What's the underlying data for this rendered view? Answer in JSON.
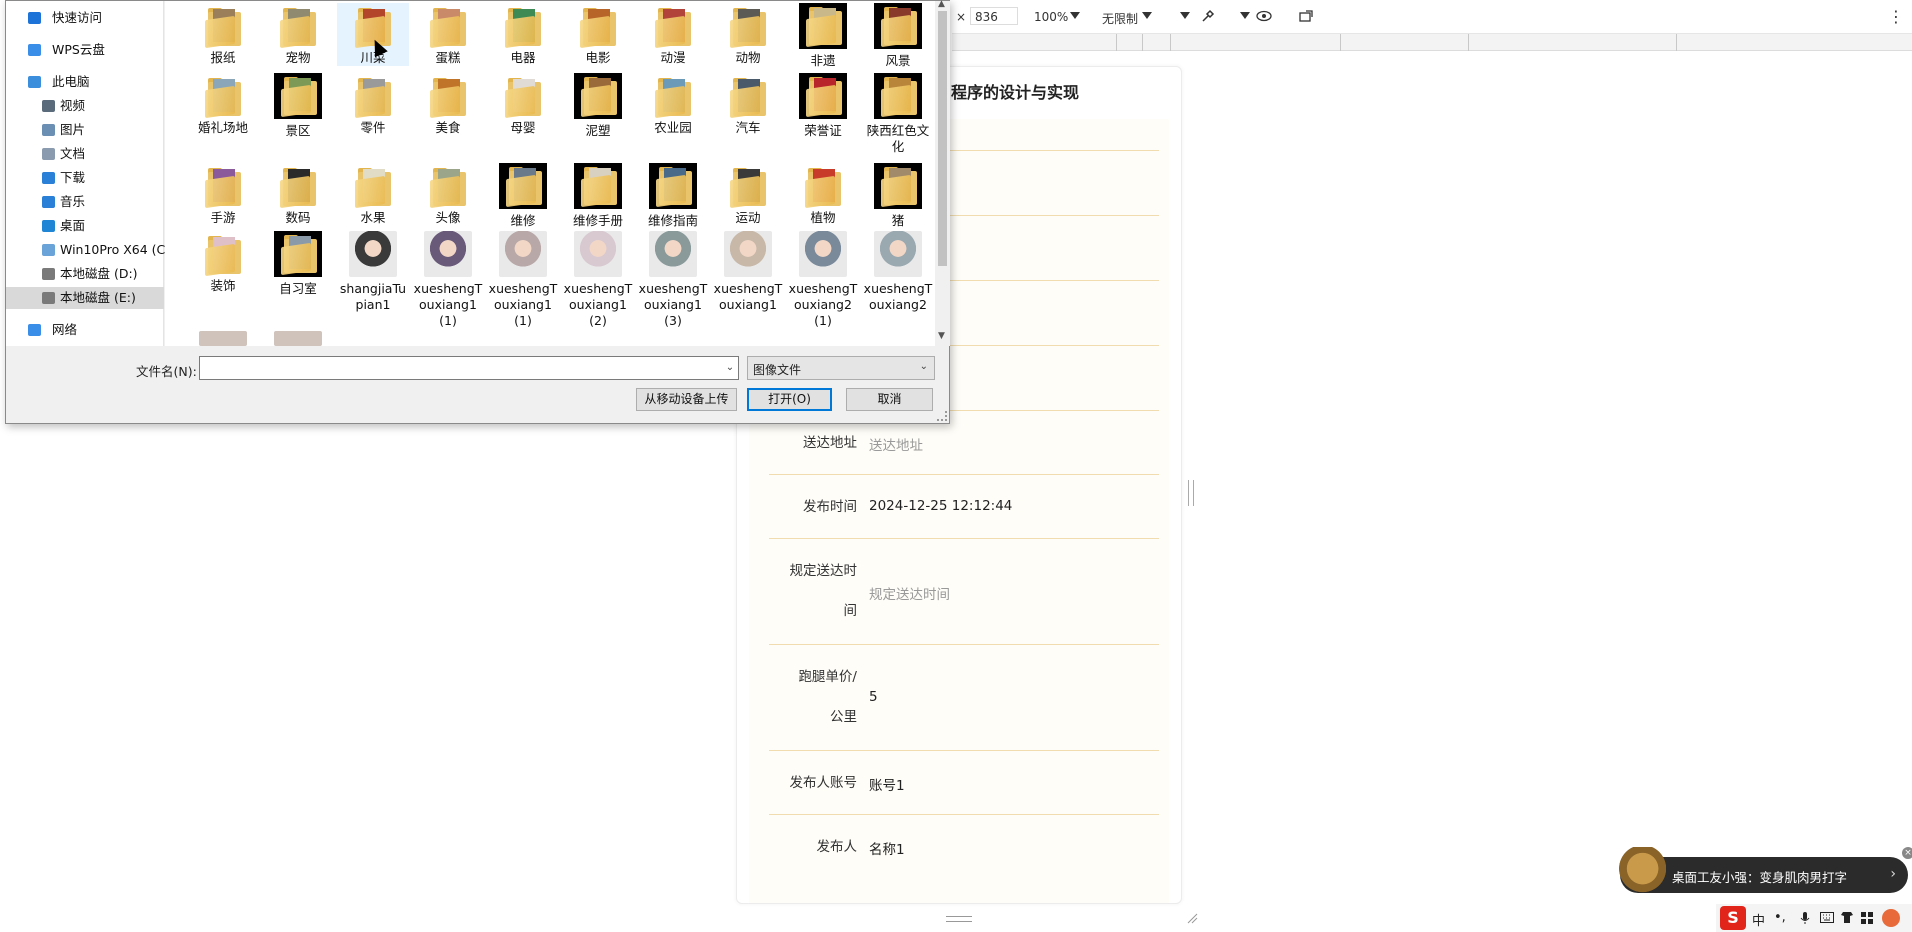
{
  "dialog": {
    "nav": [
      {
        "label": "快速访问",
        "icon": "star-icon",
        "color": "#1e73d8"
      },
      {
        "label": "WPS云盘",
        "icon": "cloud-icon",
        "color": "#3b8ee8"
      },
      {
        "label": "此电脑",
        "icon": "computer-icon",
        "color": "#3a8edb"
      },
      {
        "label": "视频",
        "icon": "video-icon",
        "color": "#5a6b7b"
      },
      {
        "label": "图片",
        "icon": "pictures-icon",
        "color": "#6b8fb3"
      },
      {
        "label": "文档",
        "icon": "documents-icon",
        "color": "#8a9bb0"
      },
      {
        "label": "下载",
        "icon": "download-icon",
        "color": "#2a7fd6"
      },
      {
        "label": "音乐",
        "icon": "music-icon",
        "color": "#2a7fd6"
      },
      {
        "label": "桌面",
        "icon": "desktop-icon",
        "color": "#1f86d6"
      },
      {
        "label": "Win10Pro X64 (C:)",
        "icon": "drive-icon",
        "color": "#6aa3d8"
      },
      {
        "label": "本地磁盘 (D:)",
        "icon": "drive-icon",
        "color": "#7a7a7a"
      },
      {
        "label": "本地磁盘 (E:)",
        "icon": "drive-icon",
        "color": "#7a7a7a"
      },
      {
        "label": "网络",
        "icon": "network-icon",
        "color": "#3b8ee8"
      }
    ],
    "files": [
      {
        "label": "报纸",
        "kind": "folder",
        "color": "#9b7f5a"
      },
      {
        "label": "宠物",
        "kind": "folder",
        "color": "#8f8a70"
      },
      {
        "label": "川菜",
        "kind": "folder",
        "color": "#b2452a"
      },
      {
        "label": "蛋糕",
        "kind": "folder",
        "color": "#c98a6a"
      },
      {
        "label": "电器",
        "kind": "folder",
        "color": "#3e8a55"
      },
      {
        "label": "电影",
        "kind": "folder",
        "color": "#b8652a"
      },
      {
        "label": "动漫",
        "kind": "folder",
        "color": "#b2433a"
      },
      {
        "label": "动物",
        "kind": "folder",
        "color": "#5c5a55"
      },
      {
        "label": "非遗",
        "kind": "folder-dark",
        "color": "#c9b98a"
      },
      {
        "label": "风景",
        "kind": "folder-dark",
        "color": "#8a3a2a"
      },
      {
        "label": "婚礼场地",
        "kind": "folder",
        "color": "#8aa6b8"
      },
      {
        "label": "景区",
        "kind": "folder-dark",
        "color": "#7c9a55"
      },
      {
        "label": "零件",
        "kind": "folder",
        "color": "#9a9a9a"
      },
      {
        "label": "美食",
        "kind": "folder",
        "color": "#c0742a"
      },
      {
        "label": "母婴",
        "kind": "folder",
        "color": "#e0dcd5"
      },
      {
        "label": "泥塑",
        "kind": "folder-dark",
        "color": "#9a6a3a"
      },
      {
        "label": "农业园",
        "kind": "folder",
        "color": "#6a9ab8"
      },
      {
        "label": "汽车",
        "kind": "folder",
        "color": "#4a5a6a"
      },
      {
        "label": "荣誉证",
        "kind": "folder-dark",
        "color": "#b8252a"
      },
      {
        "label": "陕西红色文化",
        "kind": "folder-dark",
        "color": "#b8853a"
      },
      {
        "label": "手游",
        "kind": "folder",
        "color": "#8a5a9a"
      },
      {
        "label": "数码",
        "kind": "folder",
        "color": "#2a2a2a"
      },
      {
        "label": "水果",
        "kind": "folder",
        "color": "#e0dcc5"
      },
      {
        "label": "头像",
        "kind": "folder",
        "color": "#9aa58a"
      },
      {
        "label": "维修",
        "kind": "folder-dark",
        "color": "#6a7a8a"
      },
      {
        "label": "维修手册",
        "kind": "folder-dark",
        "color": "#d8d0c0"
      },
      {
        "label": "维修指南",
        "kind": "folder-dark",
        "color": "#4a6a8a"
      },
      {
        "label": "运动",
        "kind": "folder",
        "color": "#3a3a3a"
      },
      {
        "label": "植物",
        "kind": "folder",
        "color": "#c83a2a"
      },
      {
        "label": "猪",
        "kind": "folder-dark",
        "color": "#a08a6a"
      },
      {
        "label": "装饰",
        "kind": "folder",
        "color": "#e0c0c8"
      },
      {
        "label": "自习室",
        "kind": "folder-dark",
        "color": "#8a9aa8"
      },
      {
        "label": "shangjiaTupian1",
        "kind": "photo",
        "color": "#3a3a3a"
      },
      {
        "label": "xueshengTouxiang1(1)",
        "kind": "photo",
        "color": "#6a5a7a"
      },
      {
        "label": "xueshengTouxiang1(1)",
        "kind": "photo",
        "color": "#b8a8a8"
      },
      {
        "label": "xueshengTouxiang1(2)",
        "kind": "photo",
        "color": "#d8c8d0"
      },
      {
        "label": "xueshengTouxiang1(3)",
        "kind": "photo",
        "color": "#8a9a9a"
      },
      {
        "label": "xueshengTouxiang1",
        "kind": "photo",
        "color": "#c8b8a8"
      },
      {
        "label": "xueshengTouxiang2(1)",
        "kind": "photo",
        "color": "#7a8a9a"
      },
      {
        "label": "xueshengTouxiang2",
        "kind": "photo",
        "color": "#9aa8b0"
      }
    ],
    "filename_label": "文件名(N):",
    "filename_value": "",
    "filetype": "图像文件",
    "upload_button": "从移动设备上传",
    "open_button": "打开(O)",
    "cancel_button": "取消"
  },
  "devtools": {
    "close": "×",
    "height": "836",
    "zoom": "100%",
    "throttle": "无限制",
    "menu": "⋮"
  },
  "form": {
    "title": "程序的设计与实现",
    "fields": [
      {
        "label": "送达地址",
        "value": "送达地址",
        "placeholder": true
      },
      {
        "label": "发布时间",
        "value": "2024-12-25 12:12:44",
        "placeholder": false
      },
      {
        "label": "规定送达时间",
        "value": "规定送达时间",
        "placeholder": true
      },
      {
        "label": "跑腿单价/公里",
        "value": "5",
        "placeholder": false
      },
      {
        "label": "发布人账号",
        "value": "账号1",
        "placeholder": false
      },
      {
        "label": "发布人",
        "value": "名称1",
        "placeholder": false
      }
    ]
  },
  "notification": {
    "text": "桌面工友小强：变身肌肉男打字",
    "chevron": "›"
  },
  "tray": {
    "ime": "S",
    "lang": "中",
    "punct": "•,"
  }
}
